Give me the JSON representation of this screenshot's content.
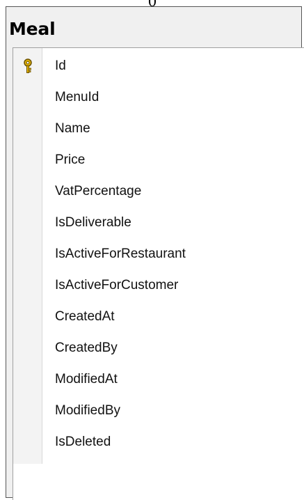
{
  "connector_label": "0",
  "table": {
    "title": "Meal",
    "columns": [
      {
        "name": "Id",
        "primary_key": true,
        "icon": "key-icon"
      },
      {
        "name": "MenuId",
        "primary_key": false
      },
      {
        "name": "Name",
        "primary_key": false
      },
      {
        "name": "Price",
        "primary_key": false
      },
      {
        "name": "VatPercentage",
        "primary_key": false
      },
      {
        "name": "IsDeliverable",
        "primary_key": false
      },
      {
        "name": "IsActiveForRestaurant",
        "primary_key": false
      },
      {
        "name": "IsActiveForCustomer",
        "primary_key": false
      },
      {
        "name": "CreatedAt",
        "primary_key": false
      },
      {
        "name": "CreatedBy",
        "primary_key": false
      },
      {
        "name": "ModifiedAt",
        "primary_key": false
      },
      {
        "name": "ModifiedBy",
        "primary_key": false
      },
      {
        "name": "IsDeleted",
        "primary_key": false
      }
    ]
  },
  "colors": {
    "key_gold": "#e0b000",
    "key_outline": "#6b5200",
    "text": "#111111"
  }
}
